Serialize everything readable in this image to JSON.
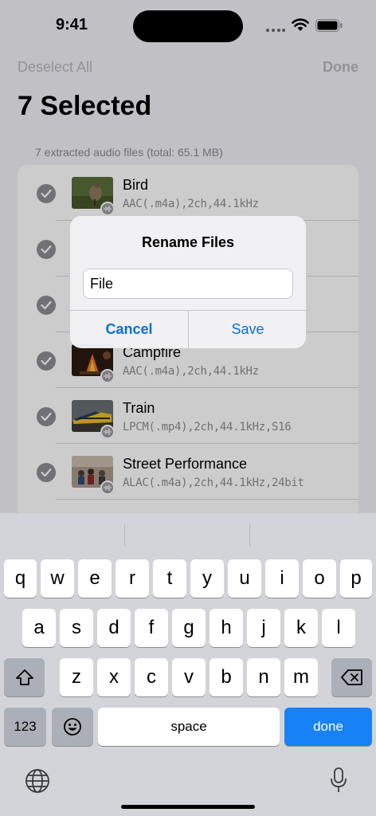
{
  "status": {
    "time": "9:41"
  },
  "nav": {
    "deselect_label": "Deselect All",
    "done_label": "Done"
  },
  "title": "7 Selected",
  "subtitle": "7 extracted audio files (total: 65.1 MB)",
  "files": [
    {
      "name": "Bird",
      "details": "AAC(.m4a),2ch,44.1kHz",
      "thumb": "bird"
    },
    {
      "name": "",
      "details": "",
      "thumb": "hidden"
    },
    {
      "name": "",
      "details": "",
      "thumb": "hidden"
    },
    {
      "name": "Campfire",
      "details": "AAC(.m4a),2ch,44.1kHz",
      "thumb": "campfire"
    },
    {
      "name": "Train",
      "details": "LPCM(.mp4),2ch,44.1kHz,S16",
      "thumb": "train"
    },
    {
      "name": "Street Performance",
      "details": "ALAC(.m4a),2ch,44.1kHz,24bit",
      "thumb": "street"
    }
  ],
  "alert": {
    "title": "Rename Files",
    "input_value": "File",
    "cancel_label": "Cancel",
    "save_label": "Save"
  },
  "keyboard": {
    "row1": [
      "q",
      "w",
      "e",
      "r",
      "t",
      "y",
      "u",
      "i",
      "o",
      "p"
    ],
    "row2": [
      "a",
      "s",
      "d",
      "f",
      "g",
      "h",
      "j",
      "k",
      "l"
    ],
    "row3": [
      "z",
      "x",
      "c",
      "v",
      "b",
      "n",
      "m"
    ],
    "numbers_label": "123",
    "space_label": "space",
    "done_label": "done"
  },
  "icons": {
    "signal": "signal-dots-icon",
    "wifi": "wifi-icon",
    "battery": "battery-icon",
    "checkmark": "checkmark-circle-icon",
    "waveform": "waveform-icon",
    "shift": "shift-icon",
    "delete": "delete-icon",
    "emoji": "emoji-icon",
    "globe": "globe-icon",
    "mic": "microphone-icon"
  },
  "colors": {
    "accent": "#0a6fd8",
    "done_key": "#1782f7",
    "check": "#8e8e93"
  }
}
